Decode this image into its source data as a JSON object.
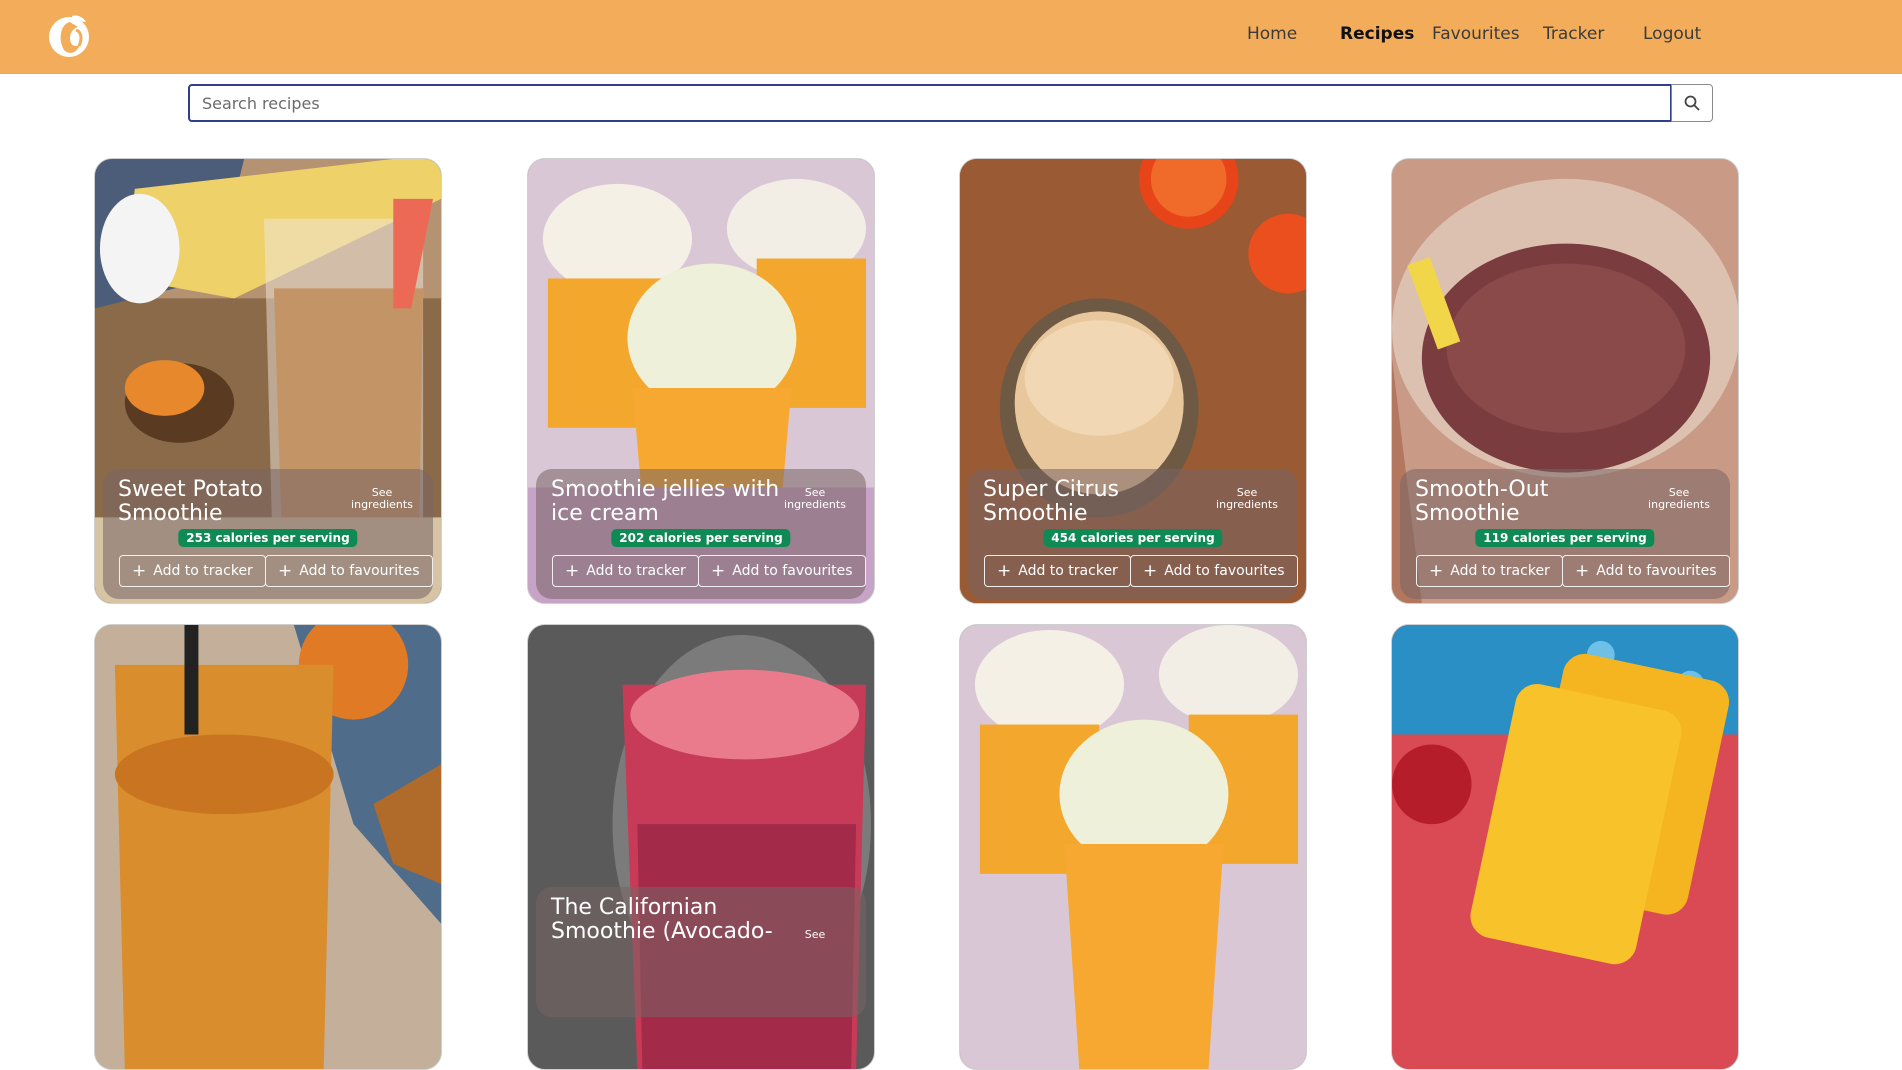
{
  "nav": {
    "links": [
      {
        "label": "Home",
        "active": false
      },
      {
        "label": "Recipes",
        "active": true
      },
      {
        "label": "Favourites",
        "active": false
      },
      {
        "label": "Tracker",
        "active": false
      },
      {
        "label": "Logout",
        "active": false
      }
    ],
    "background": "#f3ad5a"
  },
  "search": {
    "placeholder": "Search recipes",
    "icon": "search-icon"
  },
  "recipes": [
    {
      "title": "Sweet Potato Smoothie",
      "see": "See ingredients",
      "calories": "253 calories per serving",
      "add_tracker": "Add to tracker",
      "add_fav": "Add to favourites"
    },
    {
      "title": "Smoothie jellies with ice cream",
      "see": "See ingredients",
      "calories": "202 calories per serving",
      "add_tracker": "Add to tracker",
      "add_fav": "Add to favourites"
    },
    {
      "title": "Super Citrus Smoothie",
      "see": "See ingredients",
      "calories": "454 calories per serving",
      "add_tracker": "Add to tracker",
      "add_fav": "Add to favourites"
    },
    {
      "title": "Smooth-Out Smoothie",
      "see": "See ingredients",
      "calories": "119 calories per serving",
      "add_tracker": "Add to tracker",
      "add_fav": "Add to favourites"
    },
    {
      "title": "",
      "see": ""
    },
    {
      "title": "The Californian Smoothie (Avocado-",
      "see": "See"
    },
    {
      "title": "",
      "see": ""
    },
    {
      "title": "",
      "see": ""
    }
  ],
  "colors": {
    "calorie_badge": "#0f8a55",
    "search_border": "#2f3f8a"
  }
}
